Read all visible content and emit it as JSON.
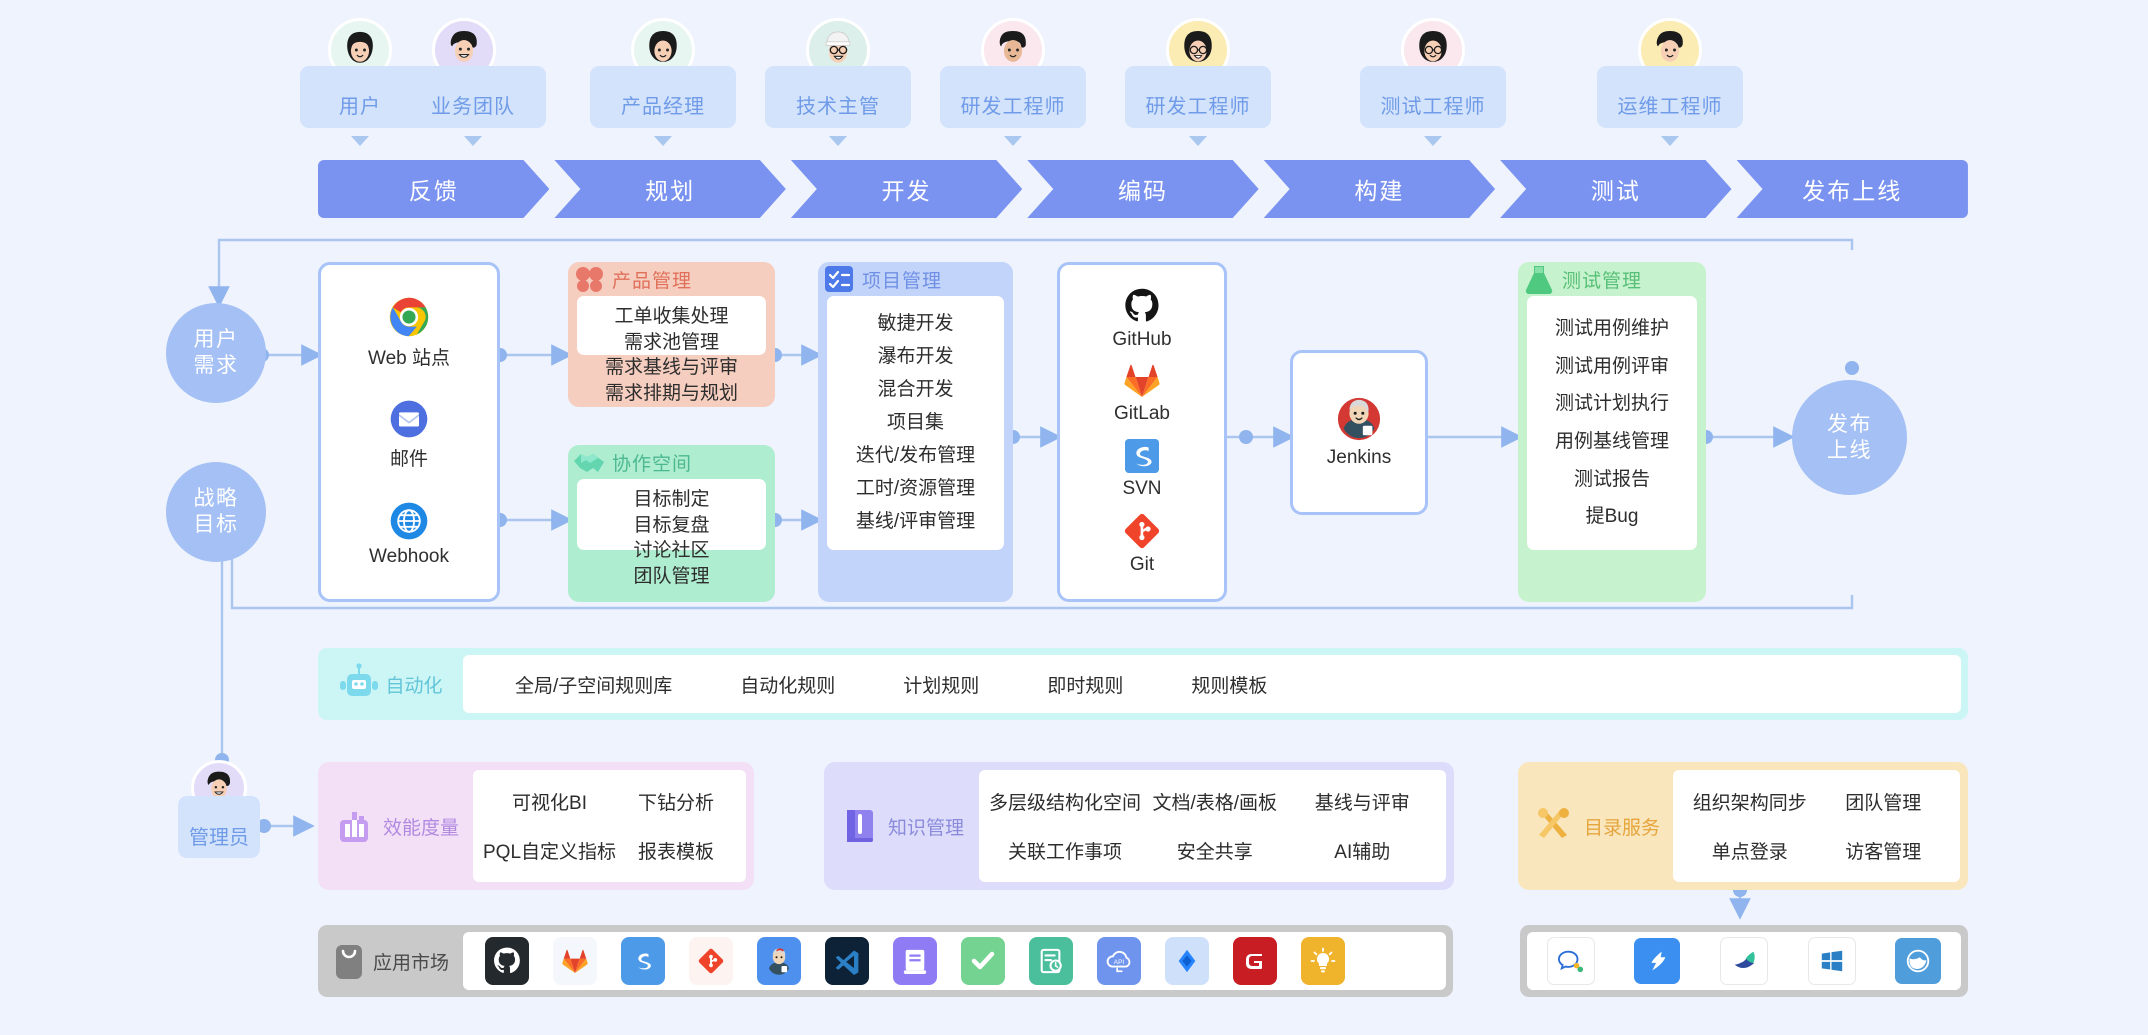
{
  "roles": [
    {
      "label": "用户",
      "avatar": "woman-purple-avatar"
    },
    {
      "label": "业务团队",
      "avatar": "man-teal-avatar"
    },
    {
      "label": "产品经理",
      "avatar": "woman-brown-avatar"
    },
    {
      "label": "技术主管",
      "avatar": "man-glasses-cap-avatar"
    },
    {
      "label": "研发工程师",
      "avatar": "man-purple-shirt-avatar"
    },
    {
      "label": "研发工程师",
      "avatar": "woman-glasses-yellow-avatar"
    },
    {
      "label": "测试工程师",
      "avatar": "woman-glasses-pink-avatar"
    },
    {
      "label": "运维工程师",
      "avatar": "man-yellow-avatar"
    }
  ],
  "pipeline": [
    "反馈",
    "规划",
    "开发",
    "编码",
    "构建",
    "测试",
    "发布上线"
  ],
  "circles": {
    "user_need": [
      "用户",
      "需求"
    ],
    "strategy_goal": [
      "战略",
      "目标"
    ],
    "release": [
      "发布",
      "上线"
    ]
  },
  "admin": {
    "label": "管理员",
    "avatar": "man-admin-avatar"
  },
  "channels": {
    "items": [
      {
        "label": "Web 站点",
        "icon": "chrome-icon"
      },
      {
        "label": "邮件",
        "icon": "mail-icon"
      },
      {
        "label": "Webhook",
        "icon": "globe-icon"
      }
    ]
  },
  "modules": {
    "product": {
      "title": "产品管理",
      "icon": "clover-icon",
      "items": [
        "工单收集处理",
        "需求池管理",
        "需求基线与评审",
        "需求排期与规划"
      ]
    },
    "collaboration": {
      "title": "协作空间",
      "icon": "handshake-icon",
      "items": [
        "目标制定",
        "目标复盘",
        "讨论社区",
        "团队管理"
      ]
    },
    "project": {
      "title": "项目管理",
      "icon": "checklist-icon",
      "items": [
        "敏捷开发",
        "瀑布开发",
        "混合开发",
        "项目集",
        "迭代/发布管理",
        "工时/资源管理",
        "基线/评审管理"
      ]
    },
    "test": {
      "title": "测试管理",
      "icon": "flask-icon",
      "items": [
        "测试用例维护",
        "测试用例评审",
        "测试计划执行",
        "用例基线管理",
        "测试报告",
        "提Bug"
      ]
    }
  },
  "scm": {
    "items": [
      {
        "label": "GitHub",
        "icon": "github-icon"
      },
      {
        "label": "GitLab",
        "icon": "gitlab-icon"
      },
      {
        "label": "SVN",
        "icon": "svn-icon"
      },
      {
        "label": "Git",
        "icon": "git-icon"
      }
    ]
  },
  "ci": {
    "items": [
      {
        "label": "Jenkins",
        "icon": "jenkins-icon"
      }
    ]
  },
  "automation": {
    "title": "自动化",
    "icon": "robot-icon",
    "items": [
      "全局/子空间规则库",
      "自动化规则",
      "计划规则",
      "即时规则",
      "规则模板"
    ]
  },
  "features": [
    {
      "title": "效能度量",
      "icon": "bar-chart-icon",
      "items": [
        "可视化BI",
        "下钻分析",
        "PQL自定义指标",
        "报表模板"
      ],
      "columns": 2
    },
    {
      "title": "知识管理",
      "icon": "book-icon",
      "items": [
        "多层级结构化空间",
        "文档/表格/画板",
        "基线与评审",
        "关联工作事项",
        "安全共享",
        "AI辅助"
      ],
      "columns": 3
    },
    {
      "title": "目录服务",
      "icon": "tools-icon",
      "items": [
        "组织架构同步",
        "团队管理",
        "单点登录",
        "访客管理"
      ],
      "columns": 2
    }
  ],
  "marketplace": {
    "title": "应用市场",
    "icon": "bag-icon",
    "apps": [
      {
        "icon": "github-icon",
        "bg": "#24292e"
      },
      {
        "icon": "gitlab-icon",
        "bg": "#f4f7fb"
      },
      {
        "icon": "svn-icon",
        "bg": "#4d9ae8"
      },
      {
        "icon": "git-icon",
        "bg": "#fdf3f0"
      },
      {
        "icon": "jenkins-icon",
        "bg": "#4d90ee"
      },
      {
        "icon": "vscode-icon",
        "bg": "#0d2137"
      },
      {
        "icon": "archive-icon",
        "bg": "#8f7cf5"
      },
      {
        "icon": "check-icon",
        "bg": "#74d391"
      },
      {
        "icon": "report-clock-icon",
        "bg": "#4bbf9b"
      },
      {
        "icon": "api-cloud-icon",
        "bg": "#6f94ee"
      },
      {
        "icon": "jira-icon",
        "bg": "#cfe0fb"
      },
      {
        "icon": "gitee-icon",
        "bg": "#c71d23"
      },
      {
        "icon": "bulb-icon",
        "bg": "#f0b32c"
      }
    ]
  },
  "integrations": {
    "apps": [
      {
        "icon": "wechat-work-icon",
        "bg": "#ffffff"
      },
      {
        "icon": "dingtalk-icon",
        "bg": "#3b8ff0"
      },
      {
        "icon": "feishu-icon",
        "bg": "#ffffff"
      },
      {
        "icon": "windows-icon",
        "bg": "#ffffff"
      },
      {
        "icon": "ad-directory-icon",
        "bg": "#4f9ddb"
      }
    ]
  },
  "colors": {
    "page_bg": "#eef3fd",
    "pipeline": "#7b93f0",
    "circle": "#a4c0f4",
    "card_border": "#a8c3f7",
    "product": "#f6cec0",
    "collaboration": "#aeedcf",
    "project": "#c3d4fb",
    "test": "#c6f3cd",
    "automation": "#ccf5f6",
    "metric": "#f3e0f7",
    "knowledge": "#ddddfb",
    "directory": "#f9e6bd",
    "marketplace": "#c9c9c9"
  }
}
